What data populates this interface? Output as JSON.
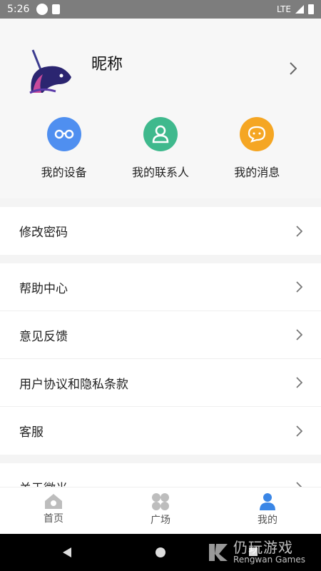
{
  "status_bar": {
    "time": "5:26",
    "network": "LTE"
  },
  "profile": {
    "nickname": "昵称"
  },
  "quick_actions": [
    {
      "label": "我的设备",
      "icon": "glasses-icon",
      "color": "#4f8ff0"
    },
    {
      "label": "我的联系人",
      "icon": "person-icon",
      "color": "#3fb98d"
    },
    {
      "label": "我的消息",
      "icon": "chat-bubble-icon",
      "color": "#f5a623"
    }
  ],
  "menu_sections": [
    {
      "items": [
        {
          "label": "修改密码"
        }
      ]
    },
    {
      "items": [
        {
          "label": "帮助中心"
        },
        {
          "label": "意见反馈"
        },
        {
          "label": "用户协议和隐私条款"
        },
        {
          "label": "客服"
        }
      ]
    },
    {
      "items": [
        {
          "label": "关于微光"
        }
      ]
    }
  ],
  "tabs": [
    {
      "label": "首页",
      "icon": "home-icon",
      "active": false
    },
    {
      "label": "广场",
      "icon": "square-grid-icon",
      "active": false
    },
    {
      "label": "我的",
      "icon": "person-icon",
      "active": true
    }
  ],
  "watermark": {
    "cn": "仍玩游戏",
    "en": "Rengwan Games"
  },
  "colors": {
    "accent": "#3a86e6",
    "inactive_icon": "#bdbdbd"
  }
}
